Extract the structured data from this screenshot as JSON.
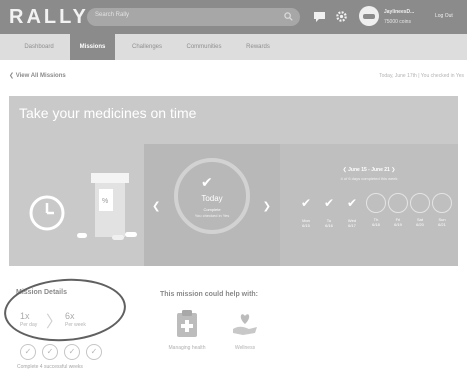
{
  "header": {
    "logo": "RALLY",
    "search_placeholder": "Search Rally",
    "user_name": "JaylineesD...",
    "coins": "75000 coins",
    "logout_label": "Log Out"
  },
  "nav": {
    "tabs": [
      {
        "label": "Dashboard",
        "active": false
      },
      {
        "label": "Missions",
        "active": true
      },
      {
        "label": "Challenges",
        "active": false
      },
      {
        "label": "Communities",
        "active": false
      },
      {
        "label": "Rewards",
        "active": false
      }
    ]
  },
  "subheader": {
    "back_link": "View All Missions",
    "today_note": "Today, June 17th | You checked in Yes"
  },
  "hero": {
    "title": "Take your medicines on time",
    "today": {
      "label": "Today",
      "status": "Complete",
      "checked_in": "You checked in Yes"
    },
    "week": {
      "range": "June 15 - June 21",
      "count": "4 of 6 days completed this week",
      "days": [
        {
          "name": "Mon",
          "date": "6/15",
          "done": true
        },
        {
          "name": "Tu",
          "date": "6/16",
          "done": true
        },
        {
          "name": "Wed",
          "date": "6/17",
          "done": true
        },
        {
          "name": "Th",
          "date": "6/18",
          "done": false
        },
        {
          "name": "Fri",
          "date": "6/19",
          "done": false
        },
        {
          "name": "Sat",
          "date": "6/20",
          "done": false
        },
        {
          "name": "Sun",
          "date": "6/21",
          "done": false
        }
      ]
    }
  },
  "mission_details": {
    "title": "Mission Details",
    "per_day_value": "1x",
    "per_day_label": "Per day",
    "per_week_value": "6x",
    "per_week_label": "Per week",
    "weeks_completed": 4,
    "complete_note": "Complete 4 successful weeks"
  },
  "help": {
    "title": "This mission could help with:",
    "items": [
      {
        "label": "Managing health",
        "icon": "medical-clipboard-icon"
      },
      {
        "label": "Wellness",
        "icon": "heart-hand-icon"
      }
    ]
  }
}
